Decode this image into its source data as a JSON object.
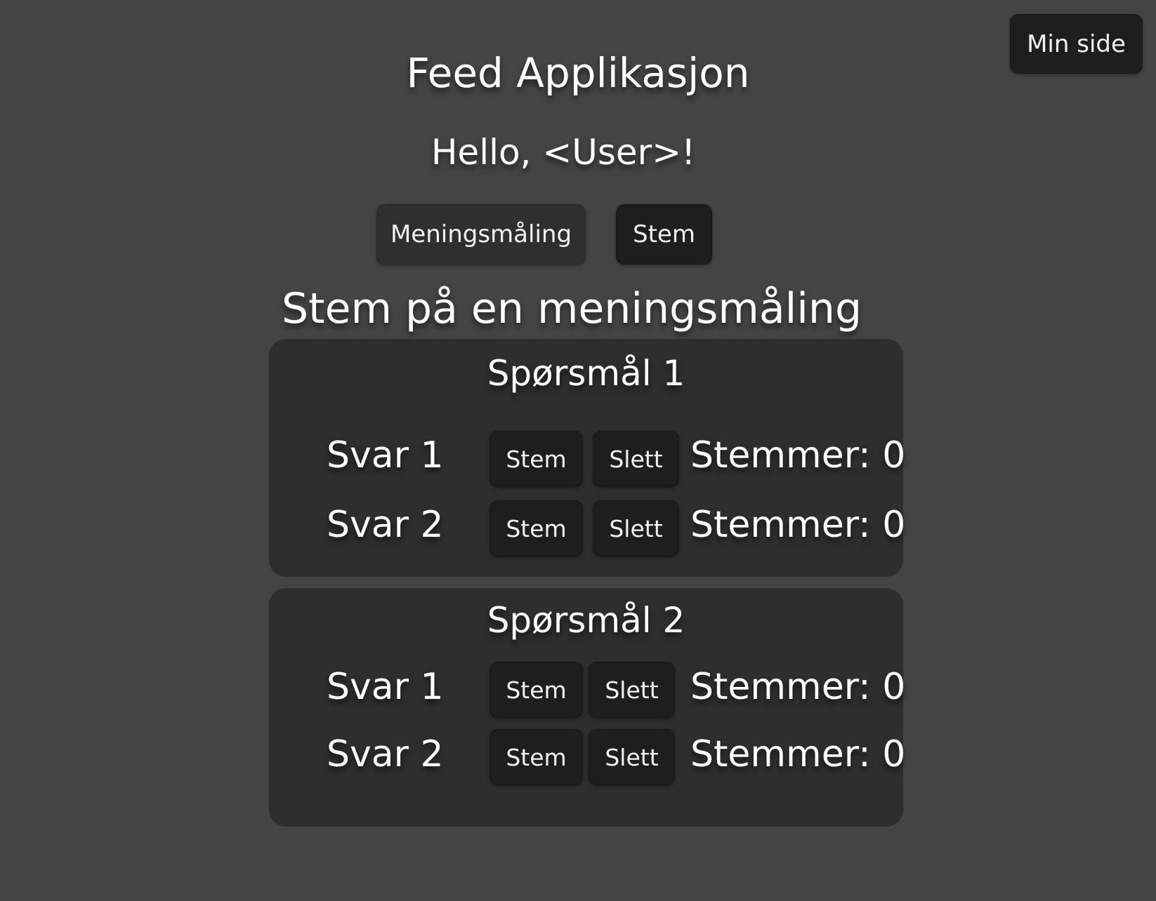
{
  "header": {
    "my_page_button": "Min side",
    "title": "Feed Applikasjon",
    "greeting": "Hello, <User>!"
  },
  "tabs": [
    {
      "label": "Meningsmåling"
    },
    {
      "label": "Stem"
    }
  ],
  "section_title": "Stem på en meningsmåling",
  "questions": [
    {
      "title": "Spørsmål 1",
      "answers": [
        {
          "label": "Svar 1",
          "vote_button": "Stem",
          "delete_button": "Slett",
          "votes_text": "Stemmer: 0"
        },
        {
          "label": "Svar 2",
          "vote_button": "Stem",
          "delete_button": "Slett",
          "votes_text": "Stemmer: 0"
        }
      ]
    },
    {
      "title": "Spørsmål 2",
      "answers": [
        {
          "label": "Svar 1",
          "vote_button": "Stem",
          "delete_button": "Slett",
          "votes_text": "Stemmer: 0"
        },
        {
          "label": "Svar 2",
          "vote_button": "Stem",
          "delete_button": "Slett",
          "votes_text": "Stemmer: 0"
        }
      ]
    }
  ],
  "colors": {
    "background": "#444444",
    "card": "#2e2e2e",
    "button": "#1e1e1e",
    "text": "#ffffff"
  }
}
